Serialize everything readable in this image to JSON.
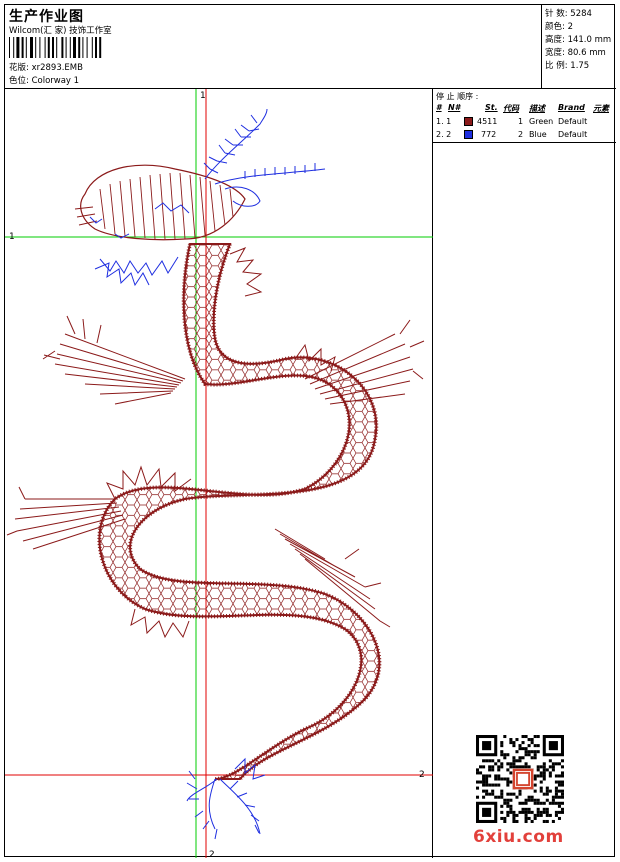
{
  "header": {
    "title": "生产作业图",
    "company": "Wilcom(汇 家) 技饰工作室",
    "pattern_label": "花版:",
    "pattern_value": "xr2893.EMB",
    "colorway_label": "色位:",
    "colorway_value": "Colorway 1"
  },
  "specs": [
    {
      "label": "针 数:",
      "value": "5284"
    },
    {
      "label": "颜色:",
      "value": "2"
    },
    {
      "label": "高度:",
      "value": "141.0 mm"
    },
    {
      "label": "宽度:",
      "value": "80.6 mm"
    },
    {
      "label": "比 例:",
      "value": "1.75"
    }
  ],
  "legend": {
    "caption": "停 止 顺序 :",
    "headers": [
      "#",
      "N#",
      "St.",
      "代码",
      "描述",
      "Brand",
      "元素"
    ],
    "rows": [
      {
        "stop": "1. 1",
        "color": "#8b1a1a",
        "stitches": "4511",
        "code": "1",
        "desc": "Green",
        "brand": "Default"
      },
      {
        "stop": "2. 2",
        "color": "#1f2fe0",
        "stitches": "772",
        "code": "2",
        "desc": "Blue",
        "brand": "Default"
      }
    ]
  },
  "markers": {
    "top": "1",
    "left": "1",
    "right": "2",
    "bottom": "2"
  },
  "watermark": "6xiu.com",
  "colors": {
    "red_line": "#e00000",
    "green_line": "#00cc00",
    "dragon_body": "#8b1a1a",
    "dragon_blue": "#1f2fe0"
  }
}
